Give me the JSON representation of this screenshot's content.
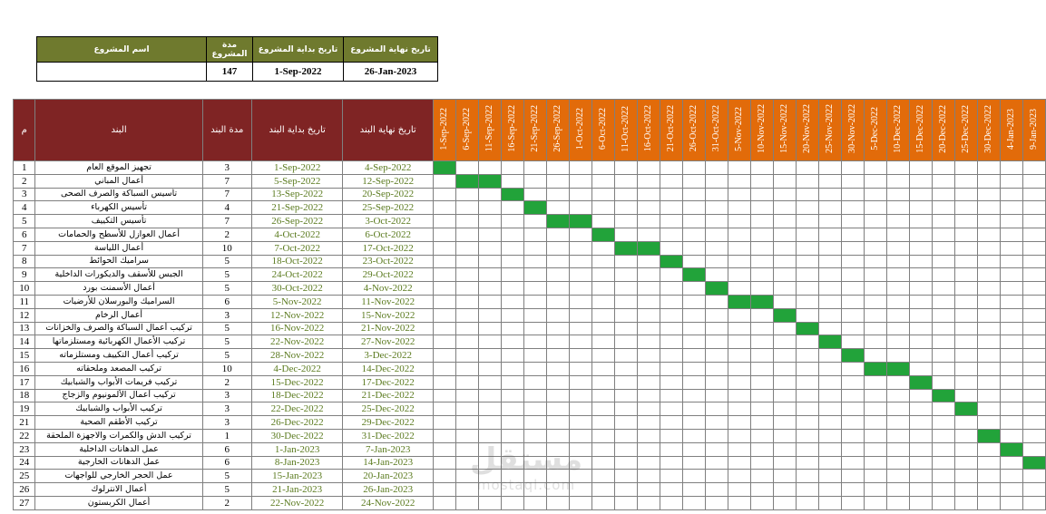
{
  "summary": {
    "headers": [
      "اسم المشروع",
      "مدة المشروع",
      "تاريخ بداية المشروع",
      "تاريخ نهاية المشروع"
    ],
    "values": [
      "",
      "147",
      "1-Sep-2022",
      "26-Jan-2023"
    ]
  },
  "table": {
    "headers": [
      "م",
      "البند",
      "مدة البند",
      "تاريخ بداية البند",
      "تاريخ نهاية البند"
    ],
    "dates": [
      "1-Sep-2022",
      "6-Sep-2022",
      "11-Sep-2022",
      "16-Sep-2022",
      "21-Sep-2022",
      "26-Sep-2022",
      "1-Oct-2022",
      "6-Oct-2022",
      "11-Oct-2022",
      "16-Oct-2022",
      "21-Oct-2022",
      "26-Oct-2022",
      "31-Oct-2022",
      "5-Nov-2022",
      "10-Nov-2022",
      "15-Nov-2022",
      "20-Nov-2022",
      "25-Nov-2022",
      "30-Nov-2022",
      "5-Dec-2022",
      "10-Dec-2022",
      "15-Dec-2022",
      "20-Dec-2022",
      "25-Dec-2022",
      "30-Dec-2022",
      "4-Jan-2023",
      "9-Jan-2023"
    ],
    "rows": [
      {
        "num": "1",
        "name": "تجهيز الموقع العام",
        "dur": "3",
        "start": "1-Sep-2022",
        "end": "4-Sep-2022",
        "bars": [
          0
        ]
      },
      {
        "num": "2",
        "name": "أعمال المباني",
        "dur": "7",
        "start": "5-Sep-2022",
        "end": "12-Sep-2022",
        "bars": [
          1,
          2
        ]
      },
      {
        "num": "3",
        "name": "تأسيس السباكة والصرف الصحى",
        "dur": "7",
        "start": "13-Sep-2022",
        "end": "20-Sep-2022",
        "bars": [
          3
        ]
      },
      {
        "num": "4",
        "name": "تأسيس الكهرباء",
        "dur": "4",
        "start": "21-Sep-2022",
        "end": "25-Sep-2022",
        "bars": [
          4
        ]
      },
      {
        "num": "5",
        "name": "تأسيس التكييف",
        "dur": "7",
        "start": "26-Sep-2022",
        "end": "3-Oct-2022",
        "bars": [
          5,
          6
        ]
      },
      {
        "num": "6",
        "name": "أعمال العوازل للأسطح والحمامات",
        "dur": "2",
        "start": "4-Oct-2022",
        "end": "6-Oct-2022",
        "bars": [
          7
        ]
      },
      {
        "num": "7",
        "name": "أعمال اللياسة",
        "dur": "10",
        "start": "7-Oct-2022",
        "end": "17-Oct-2022",
        "bars": [
          8,
          9
        ]
      },
      {
        "num": "8",
        "name": "سراميك الحوائط",
        "dur": "5",
        "start": "18-Oct-2022",
        "end": "23-Oct-2022",
        "bars": [
          10
        ]
      },
      {
        "num": "9",
        "name": "الجبس للأسقف والديكورات الداخلية",
        "dur": "5",
        "start": "24-Oct-2022",
        "end": "29-Oct-2022",
        "bars": [
          11
        ]
      },
      {
        "num": "10",
        "name": "أعمال الأسمنت بورد",
        "dur": "5",
        "start": "30-Oct-2022",
        "end": "4-Nov-2022",
        "bars": [
          12
        ]
      },
      {
        "num": "11",
        "name": "السراميك والبورسلان للأرضيات",
        "dur": "6",
        "start": "5-Nov-2022",
        "end": "11-Nov-2022",
        "bars": [
          13,
          14
        ]
      },
      {
        "num": "12",
        "name": "أعمال الرخام",
        "dur": "3",
        "start": "12-Nov-2022",
        "end": "15-Nov-2022",
        "bars": [
          15
        ]
      },
      {
        "num": "13",
        "name": "تركيب أعمال السباكة والصرف والخزانات",
        "dur": "5",
        "start": "16-Nov-2022",
        "end": "21-Nov-2022",
        "bars": [
          16
        ]
      },
      {
        "num": "14",
        "name": "تركيب الأعمال الكهربائية ومستلزماتها",
        "dur": "5",
        "start": "22-Nov-2022",
        "end": "27-Nov-2022",
        "bars": [
          17
        ]
      },
      {
        "num": "15",
        "name": "تركيب أعمال التكييف ومستلزماته",
        "dur": "5",
        "start": "28-Nov-2022",
        "end": "3-Dec-2022",
        "bars": [
          18
        ]
      },
      {
        "num": "16",
        "name": "تركيب المصعد وملحقاته",
        "dur": "10",
        "start": "4-Dec-2022",
        "end": "14-Dec-2022",
        "bars": [
          19,
          20
        ]
      },
      {
        "num": "17",
        "name": "تركيب فريمات الأبواب والشبابيك",
        "dur": "2",
        "start": "15-Dec-2022",
        "end": "17-Dec-2022",
        "bars": [
          21
        ]
      },
      {
        "num": "18",
        "name": "تركيب أعمال الألمونيوم والزجاج",
        "dur": "3",
        "start": "18-Dec-2022",
        "end": "21-Dec-2022",
        "bars": [
          22
        ]
      },
      {
        "num": "19",
        "name": "تركيب الأبواب والشبابيك",
        "dur": "3",
        "start": "22-Dec-2022",
        "end": "25-Dec-2022",
        "bars": [
          23
        ]
      },
      {
        "num": "21",
        "name": "تركيب الأطقم الصحية",
        "dur": "3",
        "start": "26-Dec-2022",
        "end": "29-Dec-2022",
        "bars": []
      },
      {
        "num": "22",
        "name": "تركيب الدش والكمرات والاجهزة الملحقة",
        "dur": "1",
        "start": "30-Dec-2022",
        "end": "31-Dec-2022",
        "bars": [
          24
        ]
      },
      {
        "num": "23",
        "name": "عمل الدهانات الداخلية",
        "dur": "6",
        "start": "1-Jan-2023",
        "end": "7-Jan-2023",
        "bars": [
          25
        ]
      },
      {
        "num": "24",
        "name": "عمل الدهانات الخارجية",
        "dur": "6",
        "start": "8-Jan-2023",
        "end": "14-Jan-2023",
        "bars": [
          26
        ]
      },
      {
        "num": "25",
        "name": "عمل الحجر الخارجي للواجهات",
        "dur": "5",
        "start": "15-Jan-2023",
        "end": "20-Jan-2023",
        "bars": []
      },
      {
        "num": "26",
        "name": "أعمال الانترلوك",
        "dur": "5",
        "start": "21-Jan-2023",
        "end": "26-Jan-2023",
        "bars": []
      },
      {
        "num": "27",
        "name": "أعمال الكربستون",
        "dur": "2",
        "start": "22-Nov-2022",
        "end": "24-Nov-2022",
        "bars": []
      }
    ]
  },
  "watermark": {
    "logo": "مستقل",
    "url": "mostaql.com"
  },
  "colors": {
    "header_main": "#7f2424",
    "header_dates": "#e26b0a",
    "summary_header": "#6f7a2e",
    "bar": "#22a33a",
    "date_text": "#5a7a1e"
  }
}
